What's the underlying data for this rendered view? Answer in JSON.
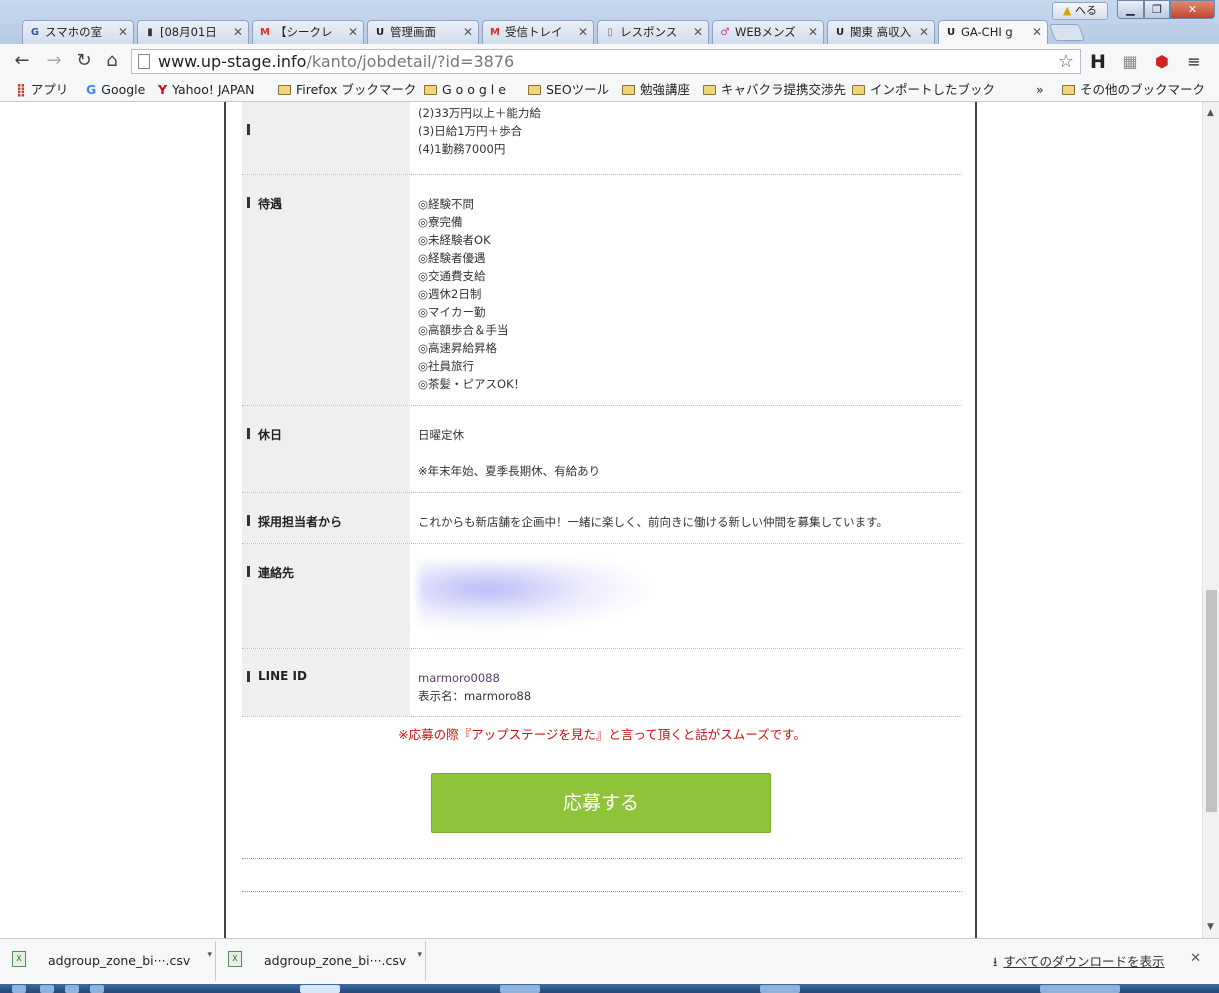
{
  "browser": {
    "user_label": "へる",
    "tabs": [
      {
        "label": "スマホの室",
        "icon": "G",
        "color": "#2a5aa8"
      },
      {
        "label": "[08月01日",
        "icon": "▮",
        "color": "#333"
      },
      {
        "label": "【シークレ",
        "icon": "M",
        "color": "#d93025"
      },
      {
        "label": "管理画面",
        "icon": "U",
        "color": "#222"
      },
      {
        "label": "受信トレイ",
        "icon": "M",
        "color": "#d93025"
      },
      {
        "label": "レスポンス",
        "icon": "▯",
        "color": "#777"
      },
      {
        "label": "WEBメンズ",
        "icon": "♂",
        "color": "#cc3399"
      },
      {
        "label": "関東 高収入",
        "icon": "U",
        "color": "#222"
      },
      {
        "label": "GA-CHI g",
        "icon": "U",
        "color": "#222"
      }
    ],
    "url_host": "www.up-stage.info",
    "url_path": "/kanto/jobdetail/?id=3876",
    "bookmarks": [
      {
        "label": "アプリ",
        "type": "apps"
      },
      {
        "label": "Google",
        "type": "google"
      },
      {
        "label": "Yahoo! JAPAN",
        "type": "yahoo"
      },
      {
        "label": "Firefox ブックマーク",
        "type": "folder"
      },
      {
        "label": "G o o g l e",
        "type": "folder"
      },
      {
        "label": "SEOツール",
        "type": "folder"
      },
      {
        "label": "勉強講座",
        "type": "folder"
      },
      {
        "label": "キャバクラ提携交渉先",
        "type": "folder"
      },
      {
        "label": "インポートしたブック",
        "type": "folder"
      },
      {
        "label": "»",
        "type": "more"
      },
      {
        "label": "その他のブックマーク",
        "type": "folder"
      }
    ]
  },
  "job": {
    "salary_lines": [
      "(2)33万円以上＋能力給",
      "(3)日給1万円＋歩合",
      "(4)1勤務7000円"
    ],
    "benefits_label": "待遇",
    "benefits": [
      "◎経験不問",
      "◎寮完備",
      "◎未経験者OK",
      "◎経験者優遇",
      "◎交通費支給",
      "◎週休2日制",
      "◎マイカー勤",
      "◎高額歩合＆手当",
      "◎高速昇給昇格",
      "◎社員旅行",
      "◎茶髪・ピアスOK！"
    ],
    "holiday_label": "休日",
    "holiday_lines": [
      "日曜定休",
      "",
      "※年末年始、夏季長期休、有給あり"
    ],
    "recruiter_label": "採用担当者から",
    "recruiter_text": "これからも新店舗を企画中！一緒に楽しく、前向きに働ける新しい仲間を募集しています。",
    "contact_label": "連絡先",
    "line_label": "LINE ID",
    "line_id": "marmoro0088",
    "line_display": "表示名：marmoro88",
    "notice": "※応募の際『アップステージを見た』と言って頂くと話がスムーズです。",
    "apply_label": "応募する"
  },
  "downloads": {
    "items": [
      {
        "name": "adgroup_zone_bi···.csv"
      },
      {
        "name": "adgroup_zone_bi···.csv"
      }
    ],
    "show_all": "すべてのダウンロードを表示"
  }
}
